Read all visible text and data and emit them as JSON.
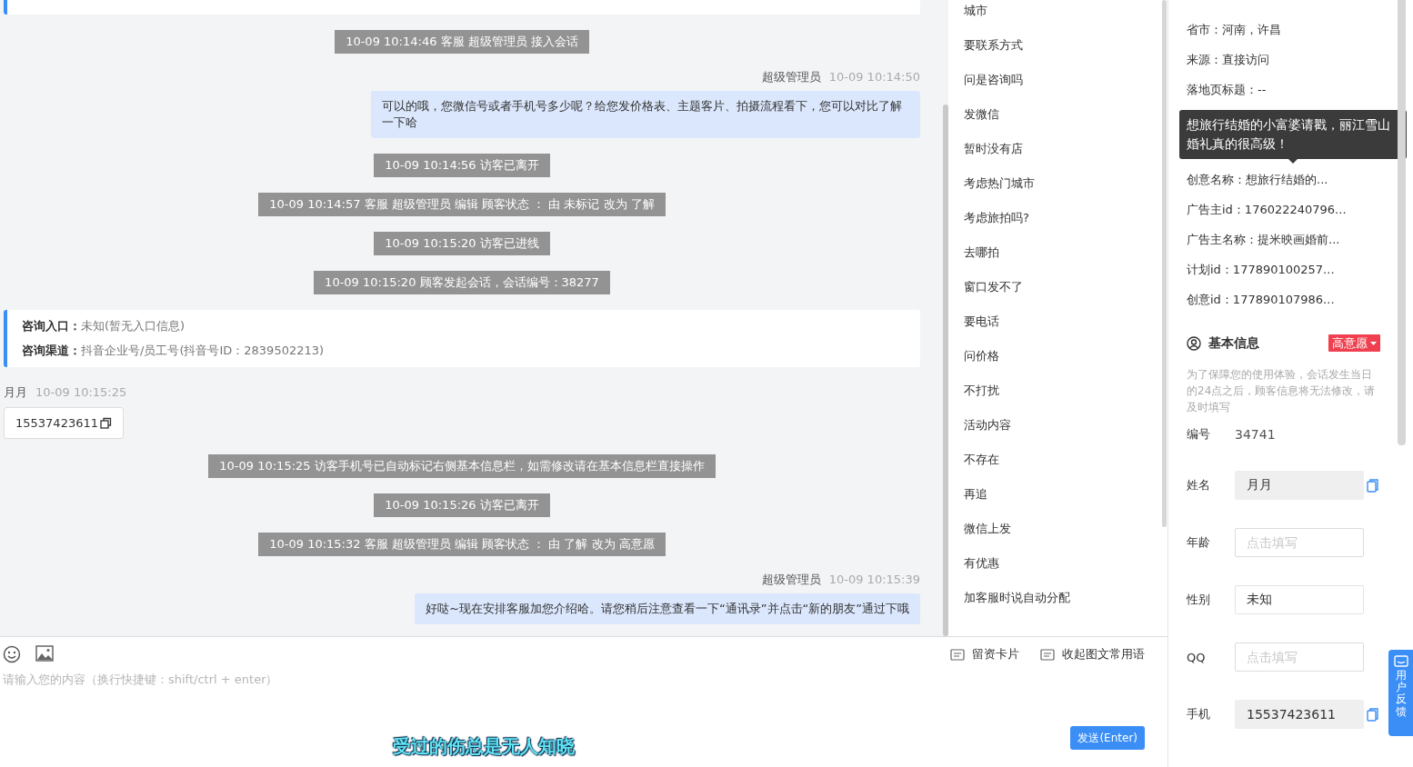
{
  "chat": {
    "messages": [
      {
        "kind": "system",
        "text": "10-09 10:14:46 客服 超级管理员 接入会话"
      },
      {
        "kind": "agent",
        "name": "超级管理员",
        "time": "10-09 10:14:50",
        "text": "可以的哦，您微信号或者手机号多少呢？给您发价格表、主题客片、拍摄流程看下，您可以对比了解一下哈"
      },
      {
        "kind": "system",
        "text": "10-09 10:14:56 访客已离开"
      },
      {
        "kind": "system",
        "text": "10-09 10:14:57 客服 超级管理员 编辑 顾客状态 ： 由 未标记 改为 了解"
      },
      {
        "kind": "system",
        "text": "10-09 10:15:20 访客已进线"
      },
      {
        "kind": "system",
        "text": "10-09 10:15:20 顾客发起会话，会话编号：38277"
      },
      {
        "kind": "info",
        "lines": [
          {
            "label": "咨询入口：",
            "value": "未知(暂无入口信息)"
          },
          {
            "label": "咨询渠道：",
            "value": "抖音企业号/员工号(抖音号ID：2839502213)"
          }
        ]
      },
      {
        "kind": "visitor",
        "name": "月月",
        "time": "10-09 10:15:25",
        "text": "15537423611"
      },
      {
        "kind": "system",
        "text": "10-09 10:15:25 访客手机号已自动标记右侧基本信息栏，如需修改请在基本信息栏直接操作"
      },
      {
        "kind": "system",
        "text": "10-09 10:15:26 访客已离开"
      },
      {
        "kind": "system",
        "text": "10-09 10:15:32 客服 超级管理员 编辑 顾客状态 ： 由 了解 改为 高意愿"
      },
      {
        "kind": "agent",
        "name": "超级管理员",
        "time": "10-09 10:15:39",
        "text": "好哒~现在安排客服加您介绍哈。请您稍后注意查看一下“通讯录”并点击“新的朋友”通过下哦"
      }
    ]
  },
  "quick_replies": [
    "城市",
    "要联系方式",
    "问是咨询吗",
    "发微信",
    "暂时没有店",
    "考虑热门城市",
    "考虑旅拍吗?",
    "去哪拍",
    "窗口发不了",
    "要电话",
    "问价格",
    "不打扰",
    "活动内容",
    "不存在",
    "再追",
    "微信上发",
    "有优惠",
    "加客服时说自动分配"
  ],
  "composer": {
    "tools": [
      "留资卡片",
      "收起图文常用语"
    ],
    "placeholder": "请输入您的内容（换行快捷键：shift/ctrl + enter）",
    "send_button": "发送(Enter)"
  },
  "desktop_lyrics": "受过的伤总是无人知晓",
  "visitor_info": {
    "rows_before_tooltip": [
      "省市：河南，许昌",
      "来源：直接访问",
      "落地页标题：--"
    ],
    "tooltip": "想旅行结婚的小富婆请戳，丽江雪山婚礼真的很高级！",
    "rows_after_tooltip": [
      "创意名称：想旅行结婚的...",
      "广告主id：176022240796...",
      "广告主名称：提米映画婚前...",
      "计划id：177890100257...",
      "创意id：177890107986..."
    ]
  },
  "basic_info": {
    "title": "基本信息",
    "status_tag": "高意愿",
    "note": "为了保障您的使用体验，会话发生当日的24点之后，顾客信息将无法修改，请及时填写",
    "fields": [
      {
        "kind": "text",
        "label": "编号",
        "value": "34741"
      },
      {
        "kind": "input",
        "label": "姓名",
        "value": "月月",
        "readonly": true,
        "copyable": true
      },
      {
        "kind": "input",
        "label": "年龄",
        "placeholder": "点击填写",
        "readonly": false,
        "copyable": false
      },
      {
        "kind": "input",
        "label": "性别",
        "value": "未知",
        "readonly": false,
        "copyable": false
      },
      {
        "kind": "input",
        "label": "QQ",
        "placeholder": "点击填写",
        "readonly": false,
        "copyable": false
      },
      {
        "kind": "input",
        "label": "手机",
        "value": "15537423611",
        "readonly": true,
        "copyable": true
      }
    ]
  },
  "feedback_button": "用户反馈"
}
